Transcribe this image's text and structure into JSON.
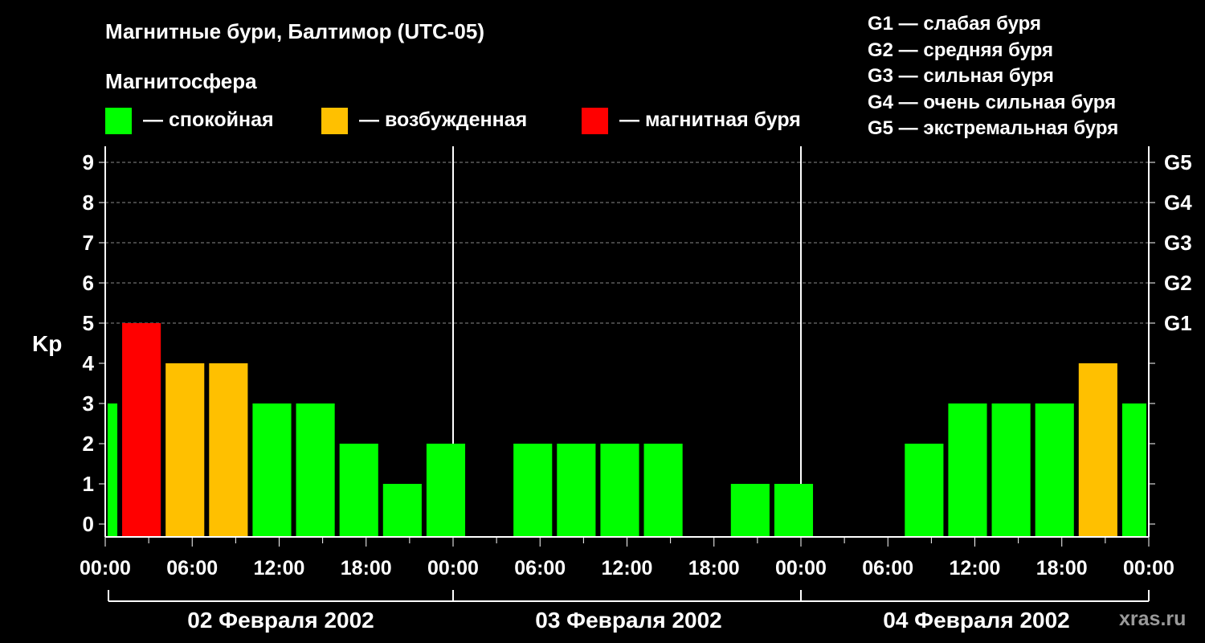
{
  "title": "Магнитные бури, Балтимор (UTC-05)",
  "magnetosphere_heading": "Магнитосфера",
  "legend": [
    {
      "label": "— спокойная",
      "color": "#00ff00"
    },
    {
      "label": "— возбужденная",
      "color": "#ffc000"
    },
    {
      "label": "— магнитная буря",
      "color": "#ff0000"
    }
  ],
  "g_scale": [
    "G1 — слабая буря",
    "G2 — средняя буря",
    "G3 — сильная буря",
    "G4 — очень сильная буря",
    "G5 — экстремальная буря"
  ],
  "watermark": "xras.ru",
  "colors": {
    "quiet": "#00ff00",
    "active": "#ffc000",
    "storm": "#ff0000"
  },
  "chart_data": {
    "type": "bar",
    "ylabel": "Kp",
    "ylim": [
      0,
      9
    ],
    "yticks": [
      0,
      1,
      2,
      3,
      4,
      5,
      6,
      7,
      8,
      9
    ],
    "right_axis_labels": [
      {
        "kp": 5,
        "label": "G1"
      },
      {
        "kp": 6,
        "label": "G2"
      },
      {
        "kp": 7,
        "label": "G3"
      },
      {
        "kp": 8,
        "label": "G4"
      },
      {
        "kp": 9,
        "label": "G5"
      }
    ],
    "xrange_hours": [
      0,
      72
    ],
    "xticks": [
      {
        "hour": 0,
        "label": "00:00"
      },
      {
        "hour": 6,
        "label": "06:00"
      },
      {
        "hour": 12,
        "label": "12:00"
      },
      {
        "hour": 18,
        "label": "18:00"
      },
      {
        "hour": 24,
        "label": "00:00"
      },
      {
        "hour": 30,
        "label": "06:00"
      },
      {
        "hour": 36,
        "label": "12:00"
      },
      {
        "hour": 42,
        "label": "18:00"
      },
      {
        "hour": 48,
        "label": "00:00"
      },
      {
        "hour": 54,
        "label": "06:00"
      },
      {
        "hour": 60,
        "label": "12:00"
      },
      {
        "hour": 66,
        "label": "18:00"
      },
      {
        "hour": 72,
        "label": "00:00"
      }
    ],
    "days": [
      "02 Февраля 2002",
      "03 Февраля 2002",
      "04 Февраля 2002"
    ],
    "grid": "dashed horizontal lines at Kp 5-9; vertical lines at day boundaries",
    "bars": [
      {
        "start": 0,
        "end": 1,
        "kp": 3,
        "level": "quiet"
      },
      {
        "start": 1,
        "end": 4,
        "kp": 5,
        "level": "storm"
      },
      {
        "start": 4,
        "end": 7,
        "kp": 4,
        "level": "active"
      },
      {
        "start": 7,
        "end": 10,
        "kp": 4,
        "level": "active"
      },
      {
        "start": 10,
        "end": 13,
        "kp": 3,
        "level": "quiet"
      },
      {
        "start": 13,
        "end": 16,
        "kp": 3,
        "level": "quiet"
      },
      {
        "start": 16,
        "end": 19,
        "kp": 2,
        "level": "quiet"
      },
      {
        "start": 19,
        "end": 22,
        "kp": 1,
        "level": "quiet"
      },
      {
        "start": 22,
        "end": 25,
        "kp": 2,
        "level": "quiet"
      },
      {
        "start": 25,
        "end": 28,
        "kp": 0,
        "level": "quiet"
      },
      {
        "start": 28,
        "end": 31,
        "kp": 2,
        "level": "quiet"
      },
      {
        "start": 31,
        "end": 34,
        "kp": 2,
        "level": "quiet"
      },
      {
        "start": 34,
        "end": 37,
        "kp": 2,
        "level": "quiet"
      },
      {
        "start": 37,
        "end": 40,
        "kp": 2,
        "level": "quiet"
      },
      {
        "start": 40,
        "end": 43,
        "kp": 0,
        "level": "quiet"
      },
      {
        "start": 43,
        "end": 46,
        "kp": 1,
        "level": "quiet"
      },
      {
        "start": 46,
        "end": 49,
        "kp": 1,
        "level": "quiet"
      },
      {
        "start": 49,
        "end": 52,
        "kp": 0,
        "level": "quiet"
      },
      {
        "start": 52,
        "end": 55,
        "kp": 0,
        "level": "quiet"
      },
      {
        "start": 55,
        "end": 58,
        "kp": 2,
        "level": "quiet"
      },
      {
        "start": 58,
        "end": 61,
        "kp": 3,
        "level": "quiet"
      },
      {
        "start": 61,
        "end": 64,
        "kp": 3,
        "level": "quiet"
      },
      {
        "start": 64,
        "end": 67,
        "kp": 3,
        "level": "quiet"
      },
      {
        "start": 67,
        "end": 70,
        "kp": 4,
        "level": "active"
      },
      {
        "start": 70,
        "end": 72,
        "kp": 3,
        "level": "quiet"
      }
    ]
  }
}
